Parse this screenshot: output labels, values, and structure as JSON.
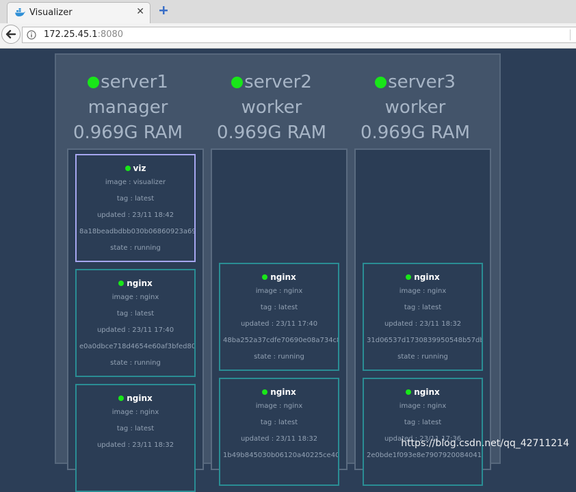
{
  "browser": {
    "tab_title": "Visualizer",
    "tab_close": "✕",
    "url_host": "172.25.45.1",
    "url_port": ":8080"
  },
  "nodes": [
    {
      "name": "server1",
      "role": "manager",
      "ram": "0.969G RAM",
      "status_color": "#19e619",
      "tasks": [
        {
          "name": "viz",
          "image": "image : visualizer",
          "tag": "tag : latest",
          "updated": "updated : 23/11 18:42",
          "id": "8a18beadbdbb030b06860923a69c",
          "state": "state : running"
        },
        {
          "name": "nginx",
          "image": "image : nginx",
          "tag": "tag : latest",
          "updated": "updated : 23/11 17:40",
          "id": "e0a0dbce718d4654e60af3bfed806",
          "state": "state : running"
        },
        {
          "name": "nginx",
          "image": "image : nginx",
          "tag": "tag : latest",
          "updated": "updated : 23/11 18:32",
          "id": "",
          "state": ""
        }
      ]
    },
    {
      "name": "server2",
      "role": "worker",
      "ram": "0.969G RAM",
      "status_color": "#19e619",
      "tasks": [
        {
          "name": "nginx",
          "image": "image : nginx",
          "tag": "tag : latest",
          "updated": "updated : 23/11 17:40",
          "id": "48ba252a37cdfe70690e08a734c84",
          "state": "state : running"
        },
        {
          "name": "nginx",
          "image": "image : nginx",
          "tag": "tag : latest",
          "updated": "updated : 23/11 18:32",
          "id": "1b49b845030b06120a40225ce402",
          "state": ""
        }
      ]
    },
    {
      "name": "server3",
      "role": "worker",
      "ram": "0.969G RAM",
      "status_color": "#19e619",
      "tasks": [
        {
          "name": "nginx",
          "image": "image : nginx",
          "tag": "tag : latest",
          "updated": "updated : 23/11 18:32",
          "id": "31d06537d1730839950548b57dbb",
          "state": "state : running"
        },
        {
          "name": "nginx",
          "image": "image : nginx",
          "tag": "tag : latest",
          "updated": "updated : 23/11 17:36",
          "id": "2e0bde1f093e8e7907920084041",
          "state": ""
        }
      ]
    }
  ],
  "watermark": "https://blog.csdn.net/qq_42711214",
  "colors": {
    "background": "#2c3e57",
    "cluster": "#43546a",
    "task_border": "#2a8d94",
    "task_highlight_border": "#a6a6f0",
    "status_green": "#19e619"
  }
}
